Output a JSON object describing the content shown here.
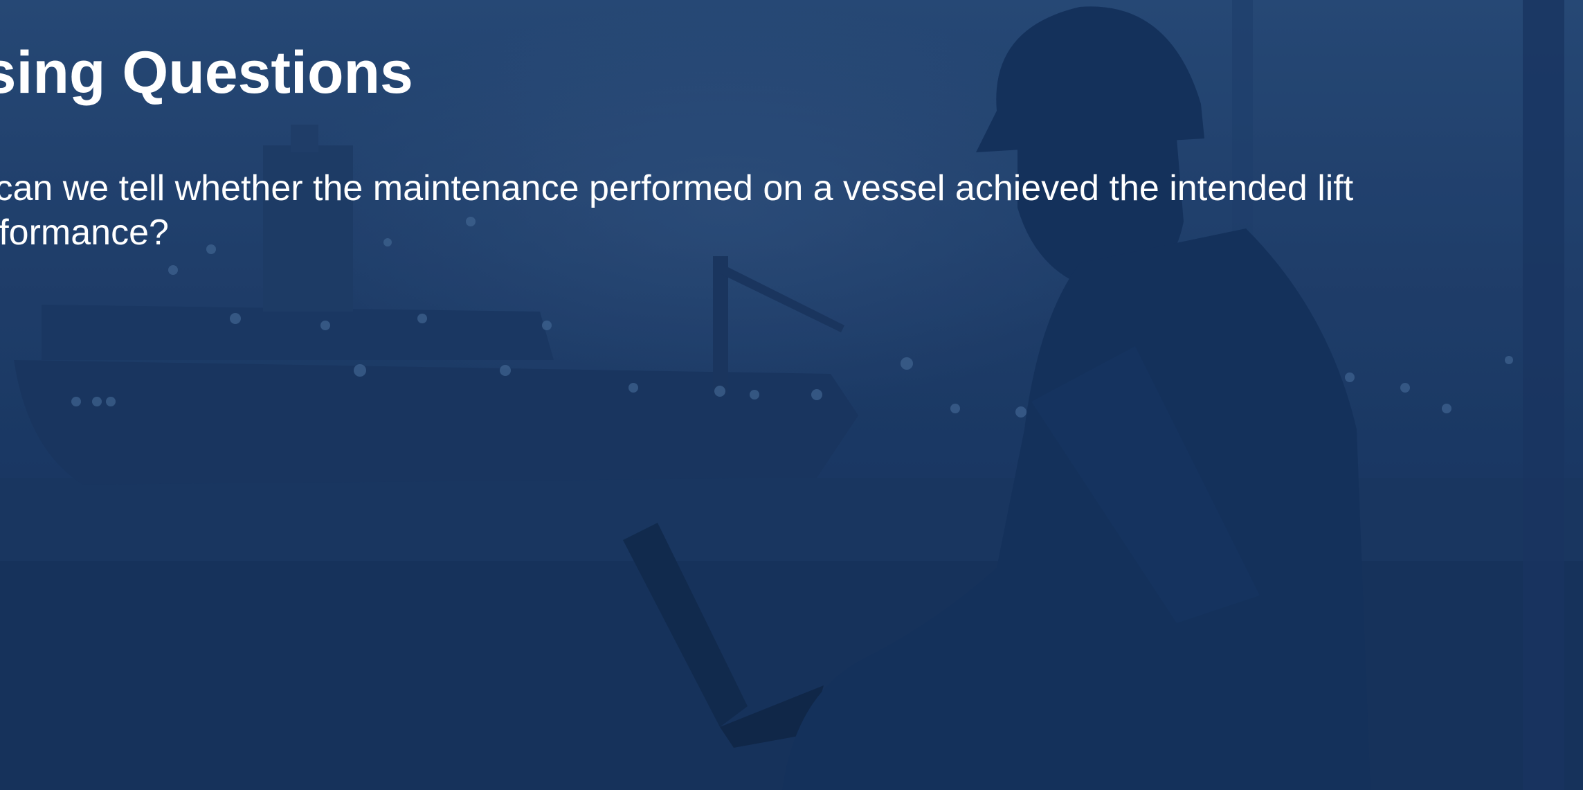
{
  "slide": {
    "title": "essing Questions",
    "body": "v can we tell whether the maintenance performed on a vessel achieved the intended lift erformance?",
    "background_tint": "#1d3c66",
    "text_color": "#ffffff"
  },
  "background_image": {
    "subject": "worker-with-laptop-at-port"
  }
}
